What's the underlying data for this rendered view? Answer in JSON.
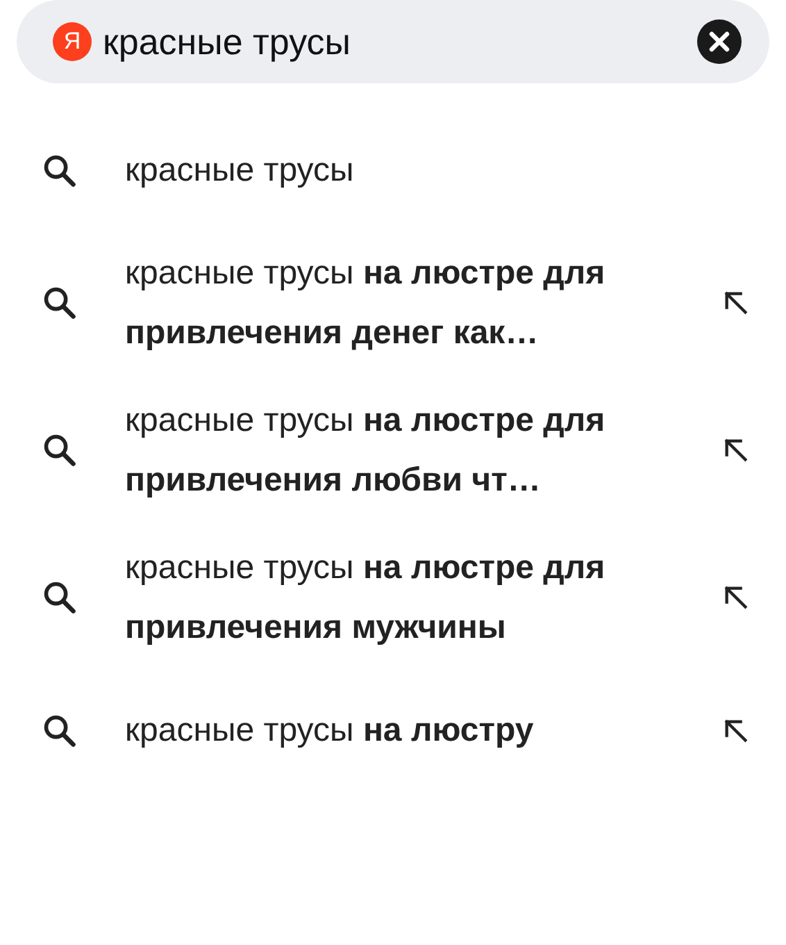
{
  "search": {
    "logo": "Я",
    "value": "красные трусы",
    "clearable": true
  },
  "suggestions": [
    {
      "text": "красные трусы",
      "insert_arrow": false
    },
    {
      "text": "красные трусы **на люстре для привлечения денег как…**",
      "insert_arrow": true
    },
    {
      "text": "красные трусы **на люстре для привлечения любви чт…**",
      "insert_arrow": true
    },
    {
      "text": "красные трусы **на люстре для привлечения мужчины**",
      "insert_arrow": true
    },
    {
      "text": "красные трусы **на люстру**",
      "insert_arrow": true
    }
  ]
}
